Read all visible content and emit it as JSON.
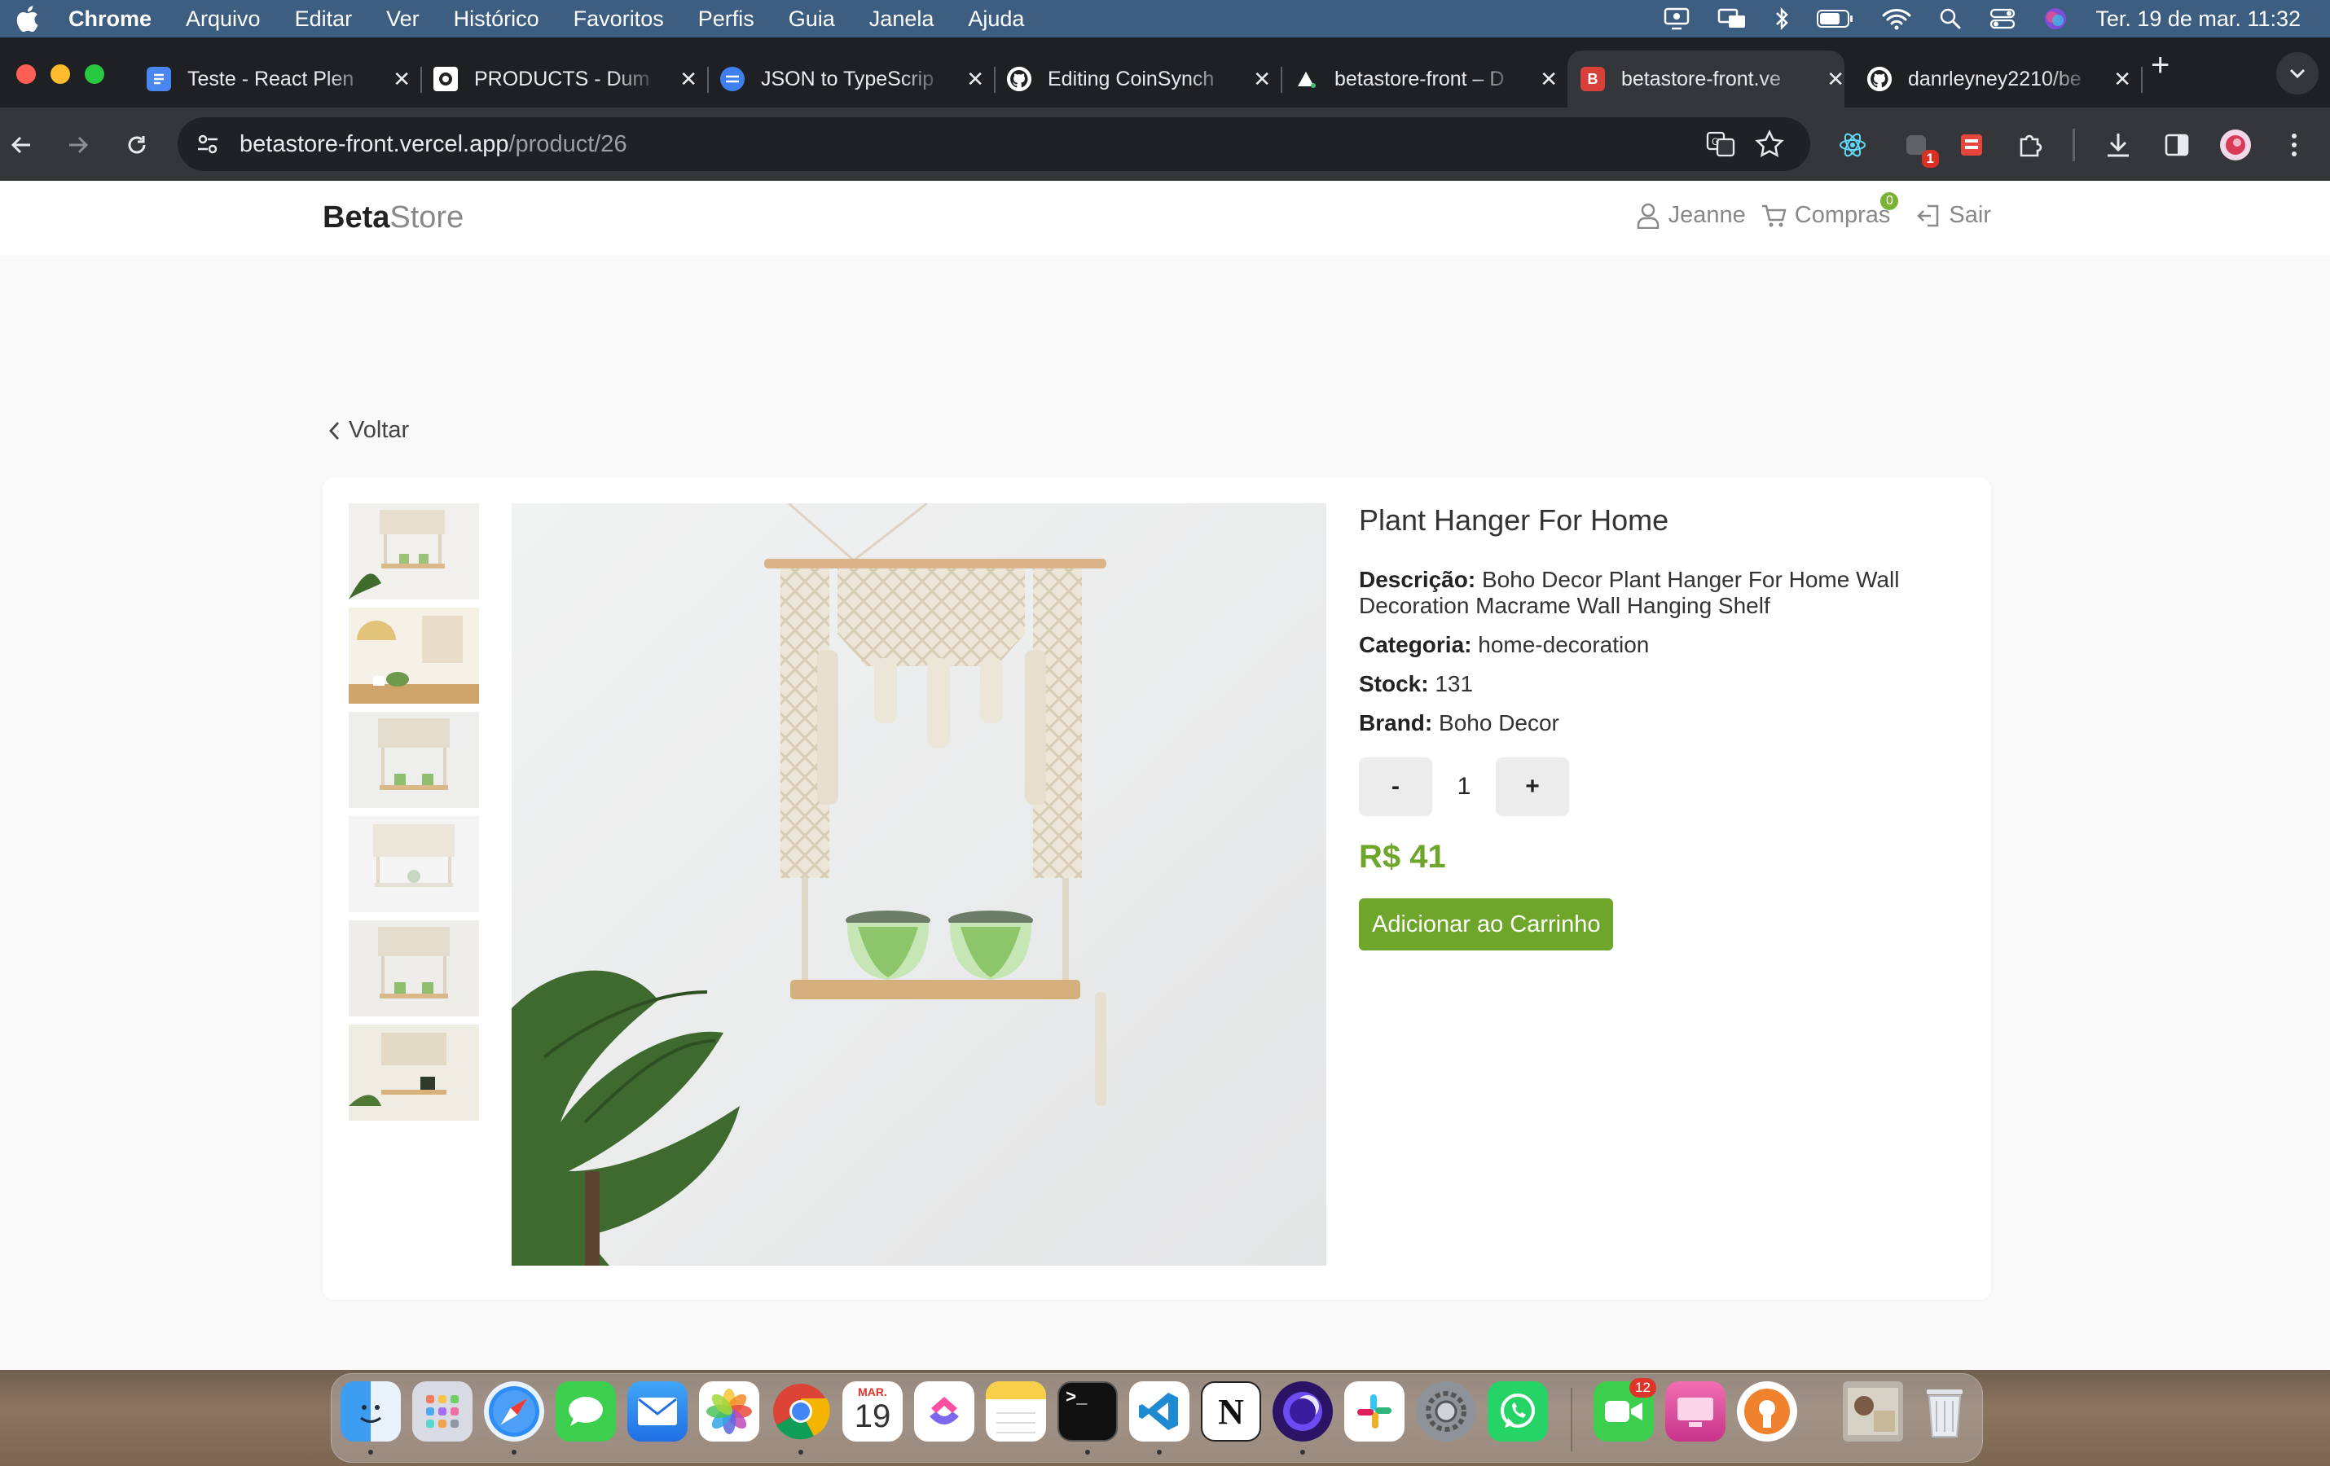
{
  "menubar": {
    "app": "Chrome",
    "items": [
      "Arquivo",
      "Editar",
      "Ver",
      "Histórico",
      "Favoritos",
      "Perfis",
      "Guia",
      "Janela",
      "Ajuda"
    ],
    "clock": "Ter. 19 de mar.  11:32"
  },
  "tabs": [
    {
      "title": "Teste - React Plen",
      "icon": "docs-icon"
    },
    {
      "title": "PRODUCTS - Dum",
      "icon": "dummyjson-icon"
    },
    {
      "title": "JSON to TypeScrip",
      "icon": "transform-icon"
    },
    {
      "title": "Editing CoinSynch",
      "icon": "github-icon"
    },
    {
      "title": "betastore-front – D",
      "icon": "vercel-icon"
    },
    {
      "title": "betastore-front.ve",
      "icon": "betastore-icon",
      "active": true
    },
    {
      "title": "danrleyney2210/be",
      "icon": "github-icon"
    }
  ],
  "omnibox": {
    "host": "betastore-front.vercel.app",
    "path": "/product/26"
  },
  "extensions": {
    "badge_count": "1"
  },
  "site": {
    "logo_bold": "Beta",
    "logo_light": "Store",
    "user": "Jeanne",
    "cart_label": "Compras",
    "cart_count": "0",
    "logout": "Sair",
    "back": "Voltar"
  },
  "product": {
    "title": "Plant Hanger For Home",
    "description_label": "Descrição:",
    "description": "Boho Decor Plant Hanger For Home Wall Decoration Macrame Wall Hanging Shelf",
    "category_label": "Categoria:",
    "category": "home-decoration",
    "stock_label": "Stock:",
    "stock": "131",
    "brand_label": "Brand:",
    "brand": "Boho Decor",
    "qty_minus": "-",
    "quantity": "1",
    "qty_plus": "+",
    "price": "R$ 41",
    "add_to_cart": "Adicionar ao Carrinho"
  },
  "dock": {
    "calendar_month": "MAR.",
    "calendar_day": "19",
    "facetime_badge": "12"
  },
  "colors": {
    "accent_green": "#6da62a",
    "menubar": "#3d5e80"
  }
}
